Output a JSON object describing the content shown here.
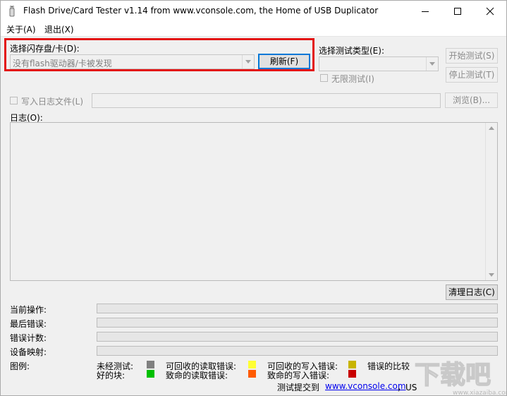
{
  "window": {
    "title": "Flash Drive/Card Tester v1.14 from www.vconsole.com, the Home of USB Duplicator"
  },
  "menu": {
    "about": "关于(A)",
    "exit": "退出(X)"
  },
  "drive": {
    "label": "选择闪存盘/卡(D):",
    "selected": "没有flash驱动器/卡被发现",
    "refresh": "刷新(F)"
  },
  "test": {
    "type_label": "选择测试类型(E):",
    "type_selected": "",
    "unlimited": "无限测试(I)",
    "start": "开始测试(S)",
    "stop": "停止测试(T)"
  },
  "logfile": {
    "label": "写入日志文件(L)",
    "path": "",
    "browse": "浏览(B)..."
  },
  "log": {
    "label": "日志(O):",
    "content": "",
    "clear": "清理日志(C)"
  },
  "status": {
    "current_op": "当前操作:",
    "last_error": "最后错误:",
    "error_count": "错误计数:",
    "device_map": "设备映射:"
  },
  "legend": {
    "title": "图例:",
    "items": [
      {
        "label": "未经测试:",
        "color": "#808080"
      },
      {
        "label": "可回收的读取错误:",
        "color": "#ffff33"
      },
      {
        "label": "可回收的写入错误:",
        "color": "#c8b400"
      },
      {
        "label": "错误的比较",
        "color": ""
      },
      {
        "label": "好的块:",
        "color": "#00c000"
      },
      {
        "label": "致命的读取错误:",
        "color": "#ff5a00"
      },
      {
        "label": "致命的写入错误:",
        "color": "#c80000"
      }
    ]
  },
  "footer": {
    "submit_label": "测试提交到",
    "link": "www.vconsole.com",
    "suffix": "，US"
  },
  "watermark": {
    "text": "下载吧",
    "url": "www.xiazaiba.com"
  }
}
